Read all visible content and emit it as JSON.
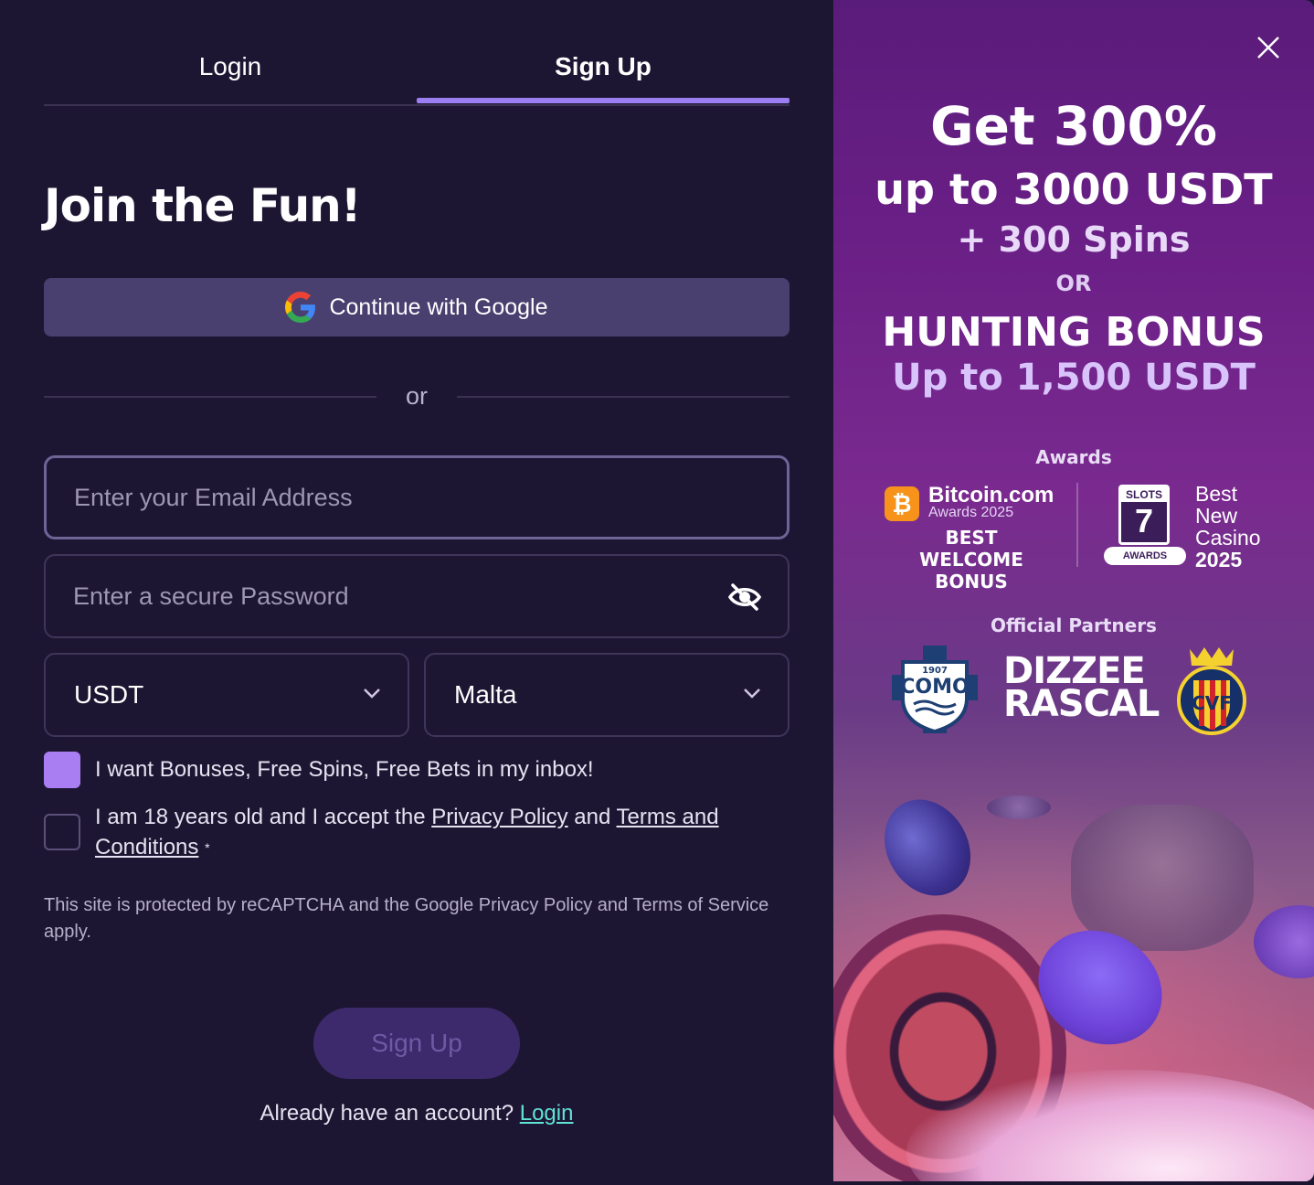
{
  "tabs": {
    "login": "Login",
    "signup": "Sign Up"
  },
  "form": {
    "title": "Join the Fun!",
    "google_button": "Continue with Google",
    "divider": "or",
    "email_placeholder": "Enter your Email Address",
    "password_placeholder": "Enter a secure Password",
    "currency": "USDT",
    "country": "Malta",
    "bonus_checkbox": {
      "label": "I want Bonuses, Free Spins, Free Bets in my inbox!",
      "checked": true
    },
    "age_checkbox": {
      "prefix": "I am 18 years old and I accept the ",
      "privacy_link": "Privacy Policy",
      "middle": " and ",
      "terms_link": "Terms and Conditions",
      "required_mark": "*",
      "checked": false
    },
    "recaptcha": "This site is protected by reCAPTCHA and the Google Privacy Policy and Terms of Service apply.",
    "submit": "Sign Up",
    "have_account": "Already have an account?",
    "login_link": "Login"
  },
  "promo": {
    "line1": "Get 300%",
    "line2": "up to 3000 USDT",
    "line3": "+ 300 Spins",
    "line4": "OR",
    "line5": "HUNTING BONUS",
    "line6": "Up to 1,500 USDT",
    "awards_title": "Awards",
    "award1": {
      "badge": "₿",
      "brand": "Bitcoin.com",
      "year": "Awards 2025",
      "line1": "BEST",
      "line2": "WELCOME BONUS"
    },
    "award2": {
      "slots": "SLOTS",
      "seven": "7",
      "ribbon": "AWARDS",
      "line1": "Best",
      "line2": "New",
      "line3": "Casino",
      "line4": "2025"
    },
    "partners_title": "Official Partners",
    "partner_como": {
      "year": "1907",
      "name": "COMO"
    },
    "partner_dizzee": {
      "line1": "DIZZEE",
      "line2": "RASCAL"
    },
    "partner_cvf": "CVF"
  },
  "colors": {
    "accent": "#9b7ef2",
    "checkbox_on": "#a97ef3",
    "link": "#5fe3d2",
    "background": "#1d1633"
  }
}
